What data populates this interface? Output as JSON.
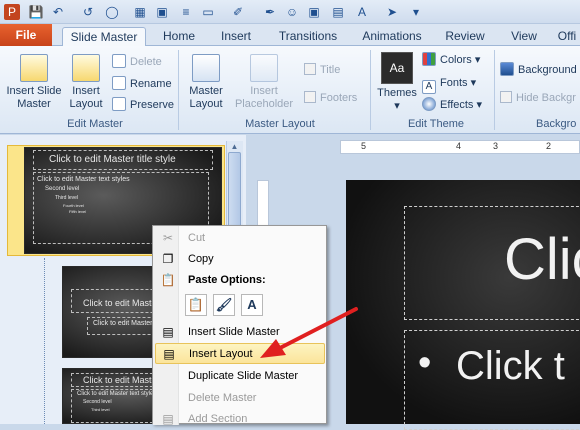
{
  "tabs": {
    "file": "File",
    "slide_master": "Slide Master",
    "home": "Home",
    "insert": "Insert",
    "transitions": "Transitions",
    "animations": "Animations",
    "review": "Review",
    "view": "View",
    "office": "Offi"
  },
  "ribbon": {
    "edit_master": {
      "insert_slide_master": [
        "Insert Slide",
        "Master"
      ],
      "insert_layout": [
        "Insert",
        "Layout"
      ],
      "delete": "Delete",
      "rename": "Rename",
      "preserve": "Preserve",
      "label": "Edit Master"
    },
    "master_layout": {
      "master_layout": [
        "Master",
        "Layout"
      ],
      "insert_placeholder": [
        "Insert",
        "Placeholder"
      ],
      "title": "Title",
      "footers": "Footers",
      "label": "Master Layout"
    },
    "edit_theme": {
      "themes": "Themes",
      "colors": "Colors",
      "fonts": "Fonts",
      "effects": "Effects",
      "label": "Edit Theme"
    },
    "background": {
      "background_styles": "Background",
      "hide_background": "Hide Backgr",
      "label": "Backgro"
    }
  },
  "thumbnails": {
    "slide_number": "1",
    "master_title": "Click to edit Master title style",
    "master_text": "Click to edit Master text styles",
    "second_level": "Second level",
    "third_level": "Third level",
    "fourth_level": "Fourth level",
    "fifth_level": "Fifth level",
    "layout_title": "Click to edit Master",
    "layout_sub": "Click to edit Master",
    "layout3_title": "Click to edit Master"
  },
  "ruler": {
    "marks": [
      "5",
      "4",
      "3",
      "2"
    ]
  },
  "slide": {
    "title_fragment": "Clic",
    "bullet_fragment": "Click t"
  },
  "context_menu": {
    "cut": "Cut",
    "copy": "Copy",
    "paste_options": "Paste Options:",
    "paste_keep_text": "A",
    "insert_slide_master": "Insert Slide Master",
    "insert_layout": "Insert Layout",
    "duplicate_slide_master": "Duplicate Slide Master",
    "delete_master": "Delete Master",
    "add_section": "Add Section"
  },
  "annotation": {
    "arrow_color": "#e02020"
  }
}
